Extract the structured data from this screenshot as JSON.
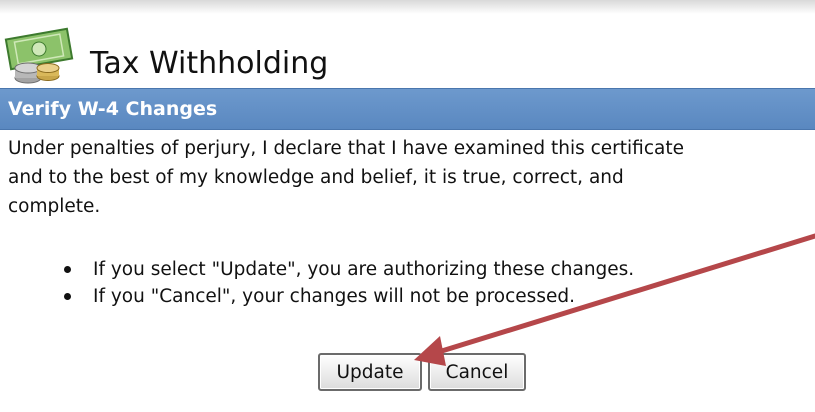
{
  "header": {
    "title": "Tax Withholding",
    "icon": "money-coins-icon"
  },
  "section": {
    "title": "Verify W-4 Changes",
    "color": "#5f8dc5"
  },
  "declaration": {
    "text": "Under penalties of perjury, I declare that I have examined this certificate\nand to the best of my knowledge and belief, it is true, correct, and\ncomplete."
  },
  "notes": [
    "If you select \"Update\", you are authorizing these changes.",
    "If you \"Cancel\", your changes will not be processed."
  ],
  "buttons": {
    "update": "Update",
    "cancel": "Cancel"
  },
  "annotation": {
    "type": "arrow",
    "color": "#b5474a",
    "points_to": "update-button"
  }
}
